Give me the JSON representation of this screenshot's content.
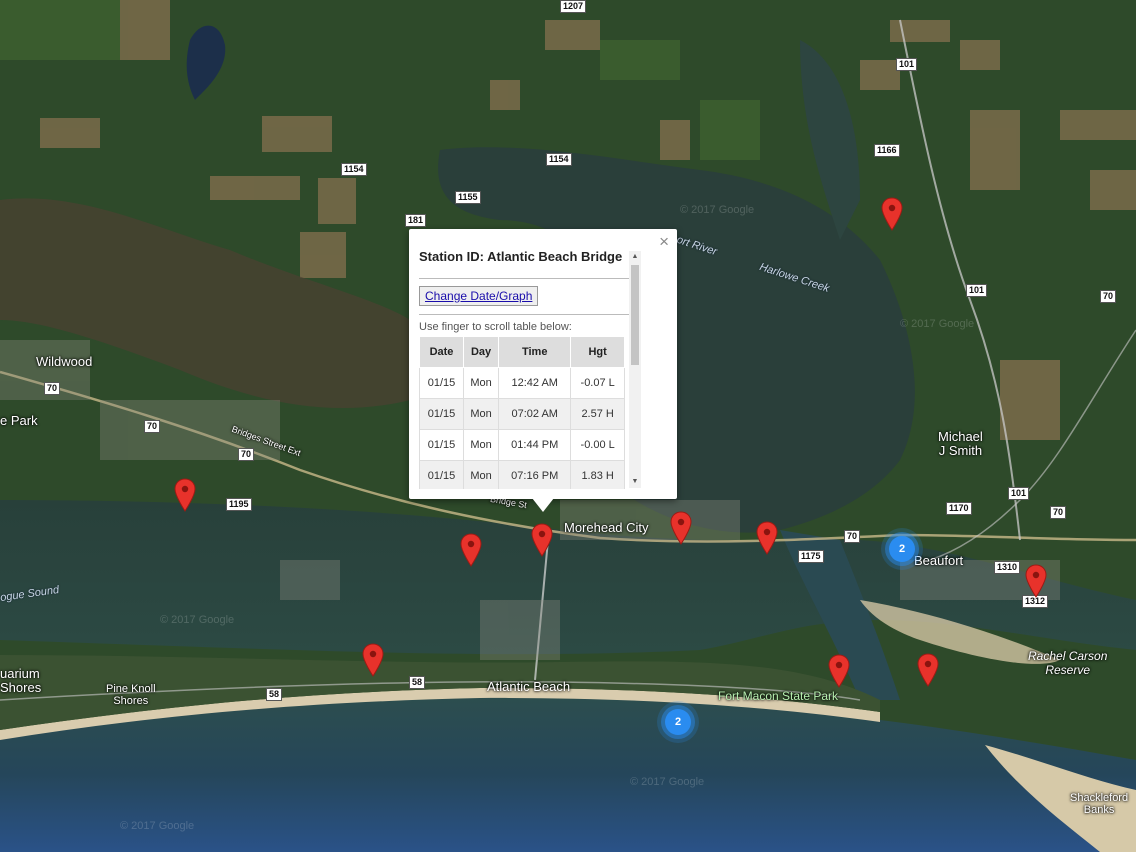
{
  "map": {
    "places": {
      "wildwood": "Wildwood",
      "park_left": "e Park",
      "morehead_city": "Morehead City",
      "beaufort": "Beaufort",
      "michael_j_smith_1": "Michael",
      "michael_j_smith_2": "J Smith",
      "atlantic_beach": "Atlantic Beach",
      "pine_knoll_1": "Pine Knoll",
      "pine_knoll_2": "Shores",
      "aquarium_1": "uarium",
      "aquarium_2": "Shores",
      "rachel_carson_1": "Rachel Carson",
      "rachel_carson_2": "Reserve",
      "shackleford_1": "Shackleford",
      "shackleford_2": "Banks",
      "fort_macon": "Fort Macon State Park",
      "bridges_st": "Bridges Street Ext",
      "bridge_st": "Bridge St"
    },
    "water": {
      "bogue_sound": "ogue Sound",
      "north_river": "ort River",
      "harlowe_creek": "Harlowe Creek"
    },
    "shields": [
      "1154",
      "1154",
      "1155",
      "181",
      "101",
      "1166",
      "101",
      "70",
      "70",
      "70",
      "70",
      "1195",
      "1175",
      "70",
      "1170",
      "101",
      "70",
      "1310",
      "1312",
      "58",
      "58",
      "1207"
    ],
    "watermark": "© 2017 Google",
    "clusters": [
      "2",
      "2"
    ]
  },
  "info_window": {
    "title": "Station ID: Atlantic Beach Bridge",
    "change_button": "Change Date/Graph",
    "scroll_hint": "Use finger to scroll table below:",
    "close": "×",
    "scroll_up": "▲",
    "scroll_down": "▼",
    "columns": [
      "Date",
      "Day",
      "Time",
      "Hgt"
    ],
    "rows": [
      {
        "date": "01/15",
        "day": "Mon",
        "time": "12:42 AM",
        "hgt": "-0.07 L"
      },
      {
        "date": "01/15",
        "day": "Mon",
        "time": "07:02 AM",
        "hgt": "2.57 H"
      },
      {
        "date": "01/15",
        "day": "Mon",
        "time": "01:44 PM",
        "hgt": "-0.00 L"
      },
      {
        "date": "01/15",
        "day": "Mon",
        "time": "07:16 PM",
        "hgt": "1.83 H"
      }
    ]
  }
}
